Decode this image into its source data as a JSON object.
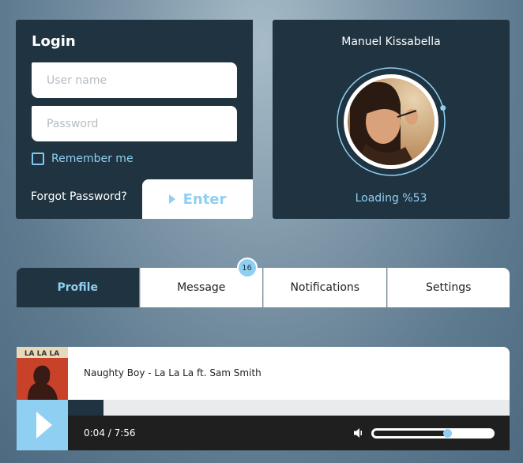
{
  "login": {
    "title": "Login",
    "username_placeholder": "User name",
    "password_placeholder": "Password",
    "remember_label": "Remember me",
    "forgot_label": "Forgot Password?",
    "enter_label": "Enter"
  },
  "profile": {
    "name": "Manuel Kissabella",
    "loading_text": "Loading %53",
    "loading_fraction": 0.53
  },
  "tabs": [
    {
      "label": "Profile",
      "active": true
    },
    {
      "label": "Message",
      "badge": "16"
    },
    {
      "label": "Notifications"
    },
    {
      "label": "Settings"
    }
  ],
  "player": {
    "album_text": "LA LA LA",
    "track_title": "Naughty Boy - La La La ft. Sam Smith",
    "time_display": "0:04 / 7:56",
    "progress_fraction": 0.08,
    "volume_fraction": 0.62
  },
  "colors": {
    "panel": "#1f3340",
    "accent": "#8fd0f2",
    "player_bar": "#1f1f1f"
  },
  "icons": {
    "play": "play-icon",
    "speaker": "speaker-icon",
    "enter": "chevron-right-icon",
    "checkbox": "checkbox-icon"
  }
}
